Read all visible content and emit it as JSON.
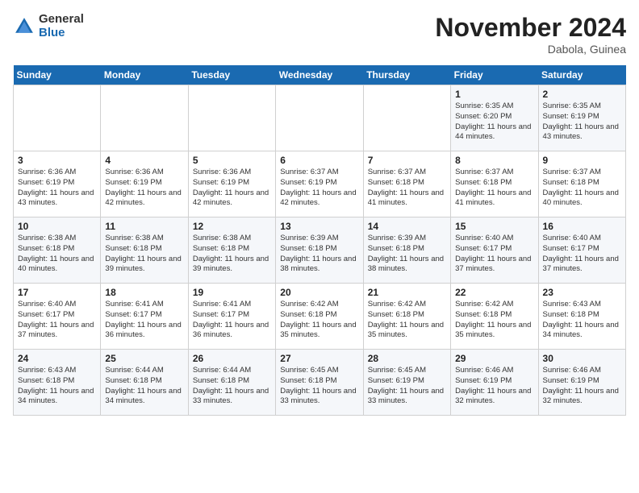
{
  "logo": {
    "general": "General",
    "blue": "Blue"
  },
  "title": "November 2024",
  "location": "Dabola, Guinea",
  "days_of_week": [
    "Sunday",
    "Monday",
    "Tuesday",
    "Wednesday",
    "Thursday",
    "Friday",
    "Saturday"
  ],
  "weeks": [
    [
      {
        "day": "",
        "info": ""
      },
      {
        "day": "",
        "info": ""
      },
      {
        "day": "",
        "info": ""
      },
      {
        "day": "",
        "info": ""
      },
      {
        "day": "",
        "info": ""
      },
      {
        "day": "1",
        "info": "Sunrise: 6:35 AM\nSunset: 6:20 PM\nDaylight: 11 hours and 44 minutes."
      },
      {
        "day": "2",
        "info": "Sunrise: 6:35 AM\nSunset: 6:19 PM\nDaylight: 11 hours and 43 minutes."
      }
    ],
    [
      {
        "day": "3",
        "info": "Sunrise: 6:36 AM\nSunset: 6:19 PM\nDaylight: 11 hours and 43 minutes."
      },
      {
        "day": "4",
        "info": "Sunrise: 6:36 AM\nSunset: 6:19 PM\nDaylight: 11 hours and 42 minutes."
      },
      {
        "day": "5",
        "info": "Sunrise: 6:36 AM\nSunset: 6:19 PM\nDaylight: 11 hours and 42 minutes."
      },
      {
        "day": "6",
        "info": "Sunrise: 6:37 AM\nSunset: 6:19 PM\nDaylight: 11 hours and 42 minutes."
      },
      {
        "day": "7",
        "info": "Sunrise: 6:37 AM\nSunset: 6:18 PM\nDaylight: 11 hours and 41 minutes."
      },
      {
        "day": "8",
        "info": "Sunrise: 6:37 AM\nSunset: 6:18 PM\nDaylight: 11 hours and 41 minutes."
      },
      {
        "day": "9",
        "info": "Sunrise: 6:37 AM\nSunset: 6:18 PM\nDaylight: 11 hours and 40 minutes."
      }
    ],
    [
      {
        "day": "10",
        "info": "Sunrise: 6:38 AM\nSunset: 6:18 PM\nDaylight: 11 hours and 40 minutes."
      },
      {
        "day": "11",
        "info": "Sunrise: 6:38 AM\nSunset: 6:18 PM\nDaylight: 11 hours and 39 minutes."
      },
      {
        "day": "12",
        "info": "Sunrise: 6:38 AM\nSunset: 6:18 PM\nDaylight: 11 hours and 39 minutes."
      },
      {
        "day": "13",
        "info": "Sunrise: 6:39 AM\nSunset: 6:18 PM\nDaylight: 11 hours and 38 minutes."
      },
      {
        "day": "14",
        "info": "Sunrise: 6:39 AM\nSunset: 6:18 PM\nDaylight: 11 hours and 38 minutes."
      },
      {
        "day": "15",
        "info": "Sunrise: 6:40 AM\nSunset: 6:17 PM\nDaylight: 11 hours and 37 minutes."
      },
      {
        "day": "16",
        "info": "Sunrise: 6:40 AM\nSunset: 6:17 PM\nDaylight: 11 hours and 37 minutes."
      }
    ],
    [
      {
        "day": "17",
        "info": "Sunrise: 6:40 AM\nSunset: 6:17 PM\nDaylight: 11 hours and 37 minutes."
      },
      {
        "day": "18",
        "info": "Sunrise: 6:41 AM\nSunset: 6:17 PM\nDaylight: 11 hours and 36 minutes."
      },
      {
        "day": "19",
        "info": "Sunrise: 6:41 AM\nSunset: 6:17 PM\nDaylight: 11 hours and 36 minutes."
      },
      {
        "day": "20",
        "info": "Sunrise: 6:42 AM\nSunset: 6:18 PM\nDaylight: 11 hours and 35 minutes."
      },
      {
        "day": "21",
        "info": "Sunrise: 6:42 AM\nSunset: 6:18 PM\nDaylight: 11 hours and 35 minutes."
      },
      {
        "day": "22",
        "info": "Sunrise: 6:42 AM\nSunset: 6:18 PM\nDaylight: 11 hours and 35 minutes."
      },
      {
        "day": "23",
        "info": "Sunrise: 6:43 AM\nSunset: 6:18 PM\nDaylight: 11 hours and 34 minutes."
      }
    ],
    [
      {
        "day": "24",
        "info": "Sunrise: 6:43 AM\nSunset: 6:18 PM\nDaylight: 11 hours and 34 minutes."
      },
      {
        "day": "25",
        "info": "Sunrise: 6:44 AM\nSunset: 6:18 PM\nDaylight: 11 hours and 34 minutes."
      },
      {
        "day": "26",
        "info": "Sunrise: 6:44 AM\nSunset: 6:18 PM\nDaylight: 11 hours and 33 minutes."
      },
      {
        "day": "27",
        "info": "Sunrise: 6:45 AM\nSunset: 6:18 PM\nDaylight: 11 hours and 33 minutes."
      },
      {
        "day": "28",
        "info": "Sunrise: 6:45 AM\nSunset: 6:19 PM\nDaylight: 11 hours and 33 minutes."
      },
      {
        "day": "29",
        "info": "Sunrise: 6:46 AM\nSunset: 6:19 PM\nDaylight: 11 hours and 32 minutes."
      },
      {
        "day": "30",
        "info": "Sunrise: 6:46 AM\nSunset: 6:19 PM\nDaylight: 11 hours and 32 minutes."
      }
    ]
  ]
}
